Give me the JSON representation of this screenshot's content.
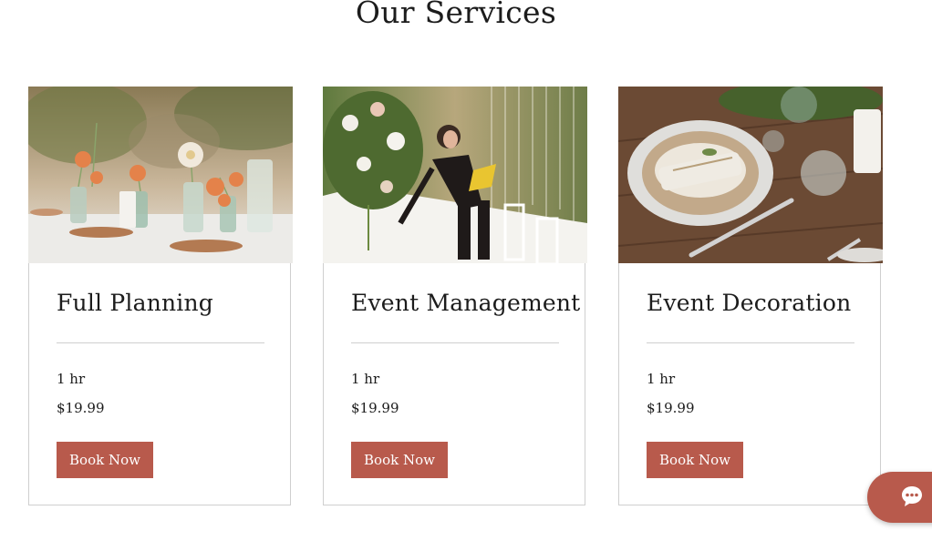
{
  "section": {
    "title": "Our Services"
  },
  "services": [
    {
      "title": "Full Planning",
      "duration": "1 hr",
      "price": "$19.99",
      "button_label": "Book Now",
      "image": "floral-table-setting-photo"
    },
    {
      "title": "Event Management",
      "duration": "1 hr",
      "price": "$19.99",
      "button_label": "Book Now",
      "image": "event-planner-arranging-flowers-photo"
    },
    {
      "title": "Event Decoration",
      "duration": "1 hr",
      "price": "$19.99",
      "button_label": "Book Now",
      "image": "plate-and-napkin-on-wood-table-photo"
    }
  ],
  "chat": {
    "icon": "chat-bubble-icon"
  },
  "colors": {
    "accent": "#b85a4c",
    "border": "#cfcfcf",
    "text": "#1c1c1c"
  }
}
